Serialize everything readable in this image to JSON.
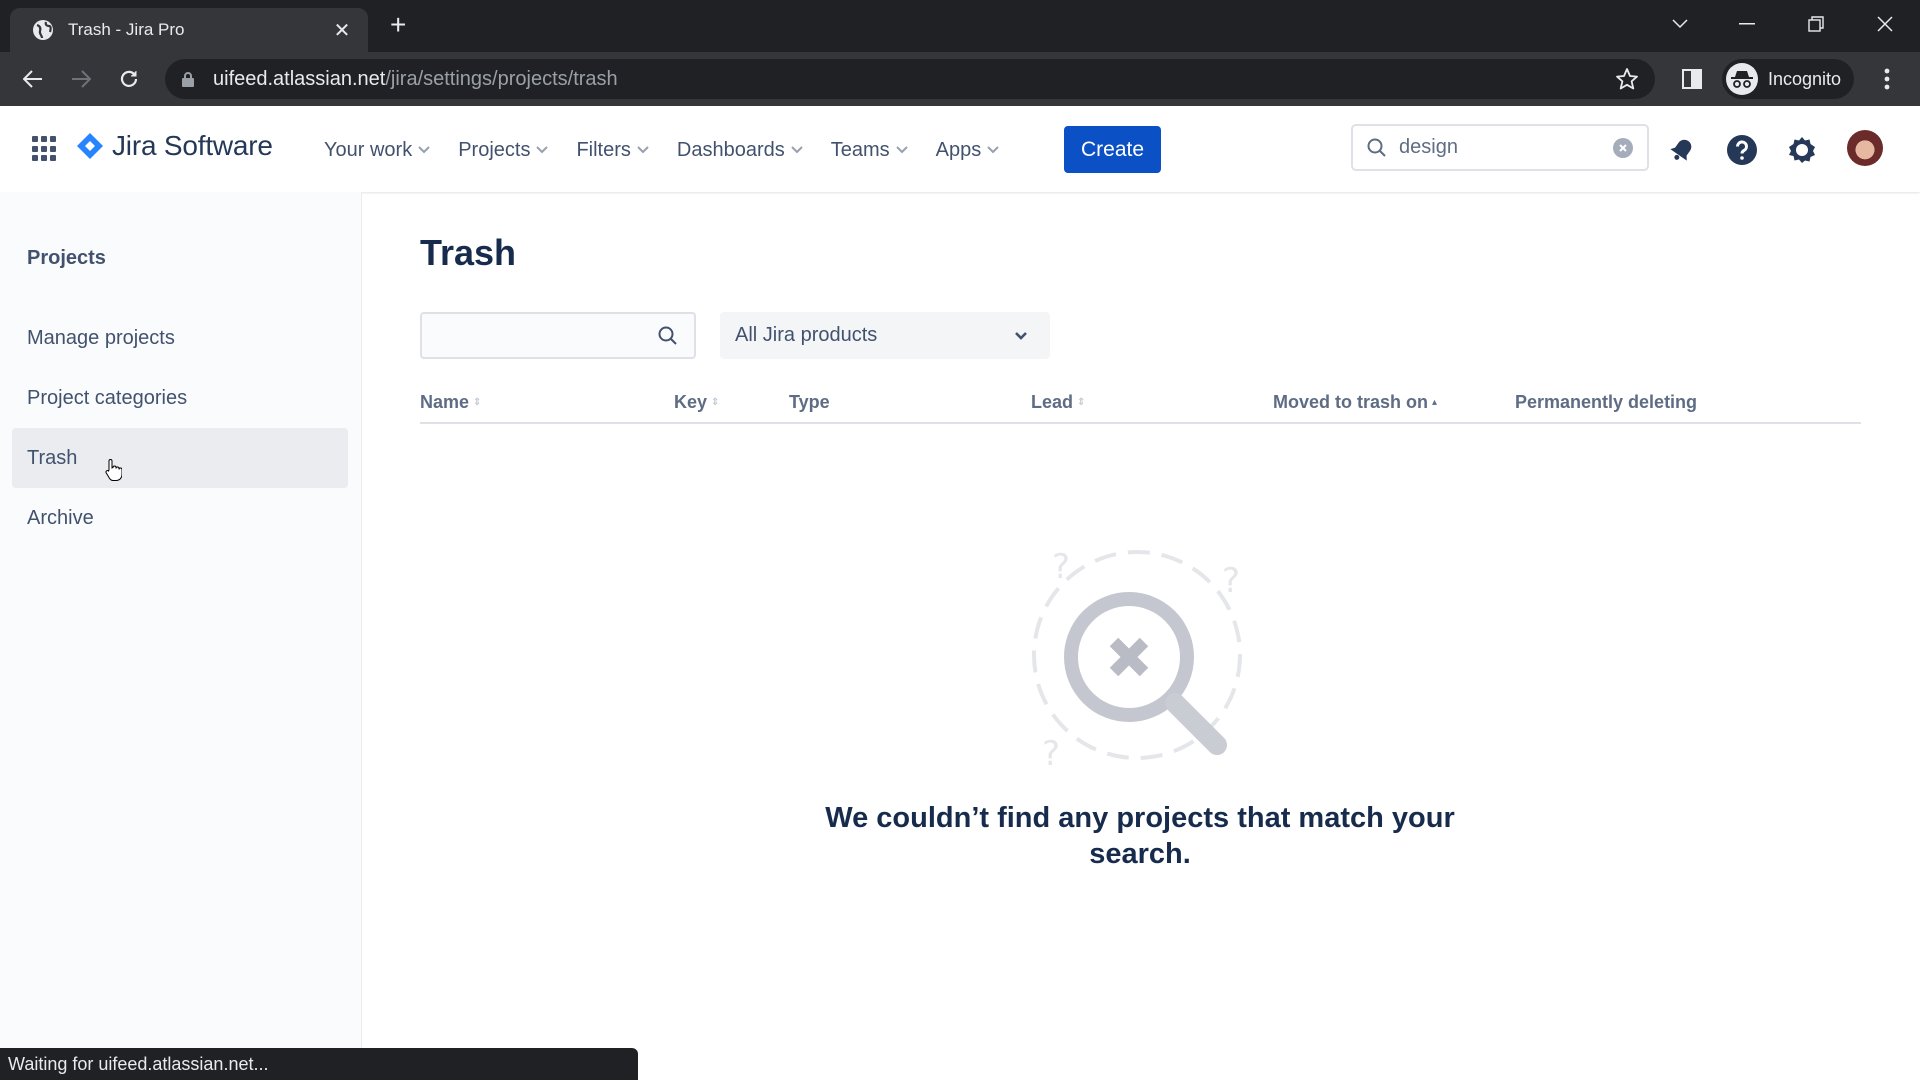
{
  "browser": {
    "tab_title": "Trash - Jira Pro",
    "url_host": "uifeed.atlassian.net",
    "url_path": "/jira/settings/projects/trash",
    "profile_label": "Incognito",
    "status_text": "Waiting for uifeed.atlassian.net..."
  },
  "header": {
    "product_name": "Jira Software",
    "nav": [
      {
        "label": "Your work"
      },
      {
        "label": "Projects"
      },
      {
        "label": "Filters"
      },
      {
        "label": "Dashboards"
      },
      {
        "label": "Teams"
      },
      {
        "label": "Apps"
      }
    ],
    "create_label": "Create",
    "search_value": "design",
    "colors": {
      "brand": "#0c50c5",
      "logo": "#2684ff"
    }
  },
  "sidebar": {
    "heading": "Projects",
    "items": [
      {
        "label": "Manage projects",
        "active": false
      },
      {
        "label": "Project categories",
        "active": false
      },
      {
        "label": "Trash",
        "active": true
      },
      {
        "label": "Archive",
        "active": false
      }
    ]
  },
  "main": {
    "title": "Trash",
    "filter_placeholder": "",
    "product_select": "All Jira products",
    "columns": [
      {
        "label": "Name",
        "sortable": true
      },
      {
        "label": "Key",
        "sortable": true
      },
      {
        "label": "Type",
        "sortable": false
      },
      {
        "label": "Lead",
        "sortable": true
      },
      {
        "label": "Moved to trash on",
        "sortable": true,
        "sorted": "asc"
      },
      {
        "label": "Permanently deleting",
        "sortable": false
      }
    ],
    "rows": [],
    "empty_message": "We couldn’t find any projects that match your search."
  }
}
